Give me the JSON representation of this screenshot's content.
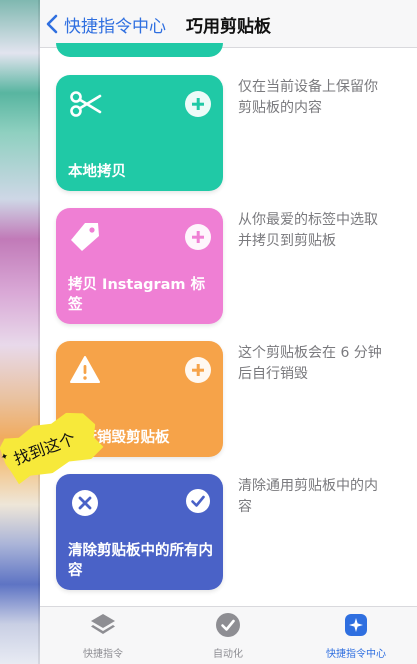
{
  "nav": {
    "back_label": "快捷指令中心",
    "title": "巧用剪贴板"
  },
  "rows": [
    {
      "card_title": "本地拷贝",
      "card_color": "#20c9a6",
      "icon": "scissors-icon",
      "action": "add",
      "description": "仅在当前设备上保留你剪贴板的内容"
    },
    {
      "card_title": "拷贝 Instagram 标签",
      "card_color": "#ef7fd4",
      "icon": "tag-icon",
      "action": "add",
      "description": "从你最爱的标签中选取并拷贝到剪贴板"
    },
    {
      "card_title": "自行销毁剪贴板",
      "card_color": "#f6a349",
      "icon": "warning-icon",
      "action": "add",
      "description": "这个剪贴板会在 6 分钟后自行销毁"
    },
    {
      "card_title": "清除剪贴板中的所有内容",
      "card_color": "#4a62c7",
      "icon": "close-circle-icon",
      "action": "added",
      "description": "清除通用剪贴板中的内容"
    }
  ],
  "sticker": {
    "text": "找到这个"
  },
  "tabbar": {
    "tabs": [
      {
        "label": "快捷指令",
        "icon": "layers-icon",
        "active": false
      },
      {
        "label": "自动化",
        "icon": "checkmark-circle-icon",
        "active": false
      },
      {
        "label": "快捷指令中心",
        "icon": "sparkle-icon",
        "active": true
      }
    ]
  },
  "colors": {
    "accent": "#2f6fe0"
  }
}
